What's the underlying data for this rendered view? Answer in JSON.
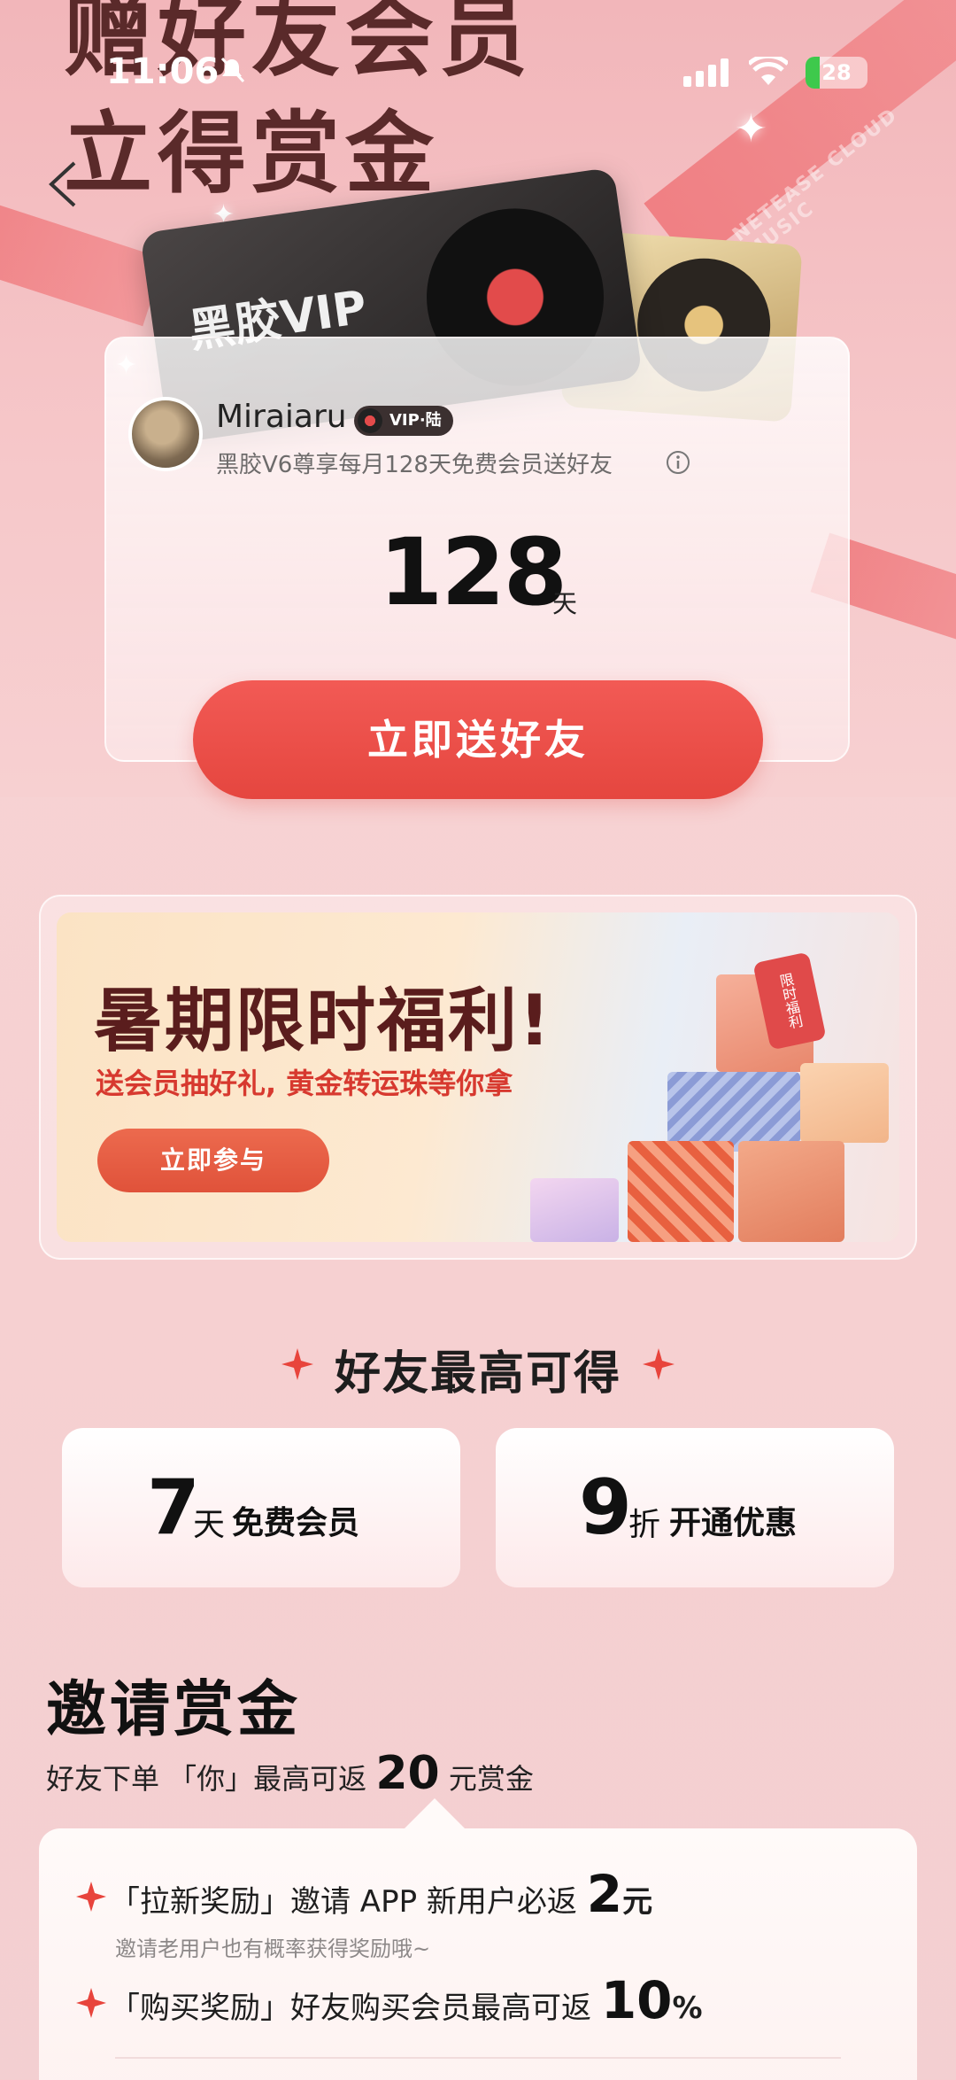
{
  "status_bar": {
    "time": "11:06",
    "battery": "28"
  },
  "hero": {
    "headline_line1": "赠好友会员",
    "headline_line2": "立得赏金",
    "ribbon_text": "NETEASE CLOUD MUSIC",
    "vinyl_card_text": "黑胶VIP"
  },
  "profile": {
    "username": "Miraiaru",
    "vip_badge": "VIP·陆",
    "description": "黑胶V6尊享每月128天免费会员送好友",
    "days_value": "128",
    "days_unit": "天",
    "send_button": "立即送好友"
  },
  "promo": {
    "title": "暑期限时福利!",
    "subtitle": "送会员抽好礼, 黄金转运珠等你拿",
    "button": "立即参与",
    "tag": "限时福利"
  },
  "friends": {
    "title": "好友最高可得",
    "benefit1": {
      "num": "7",
      "unit": "天",
      "label": "免费会员"
    },
    "benefit2": {
      "num": "9",
      "unit": "折",
      "label": "开通优惠"
    }
  },
  "bounty": {
    "title": "邀请赏金",
    "sub_prefix": "好友下单 「你」最高可返",
    "sub_amount": "20",
    "sub_suffix": "元赏金",
    "rule1_text": "「拉新奖励」邀请 APP 新用户必返",
    "rule1_amount": "2",
    "rule1_unit": "元",
    "rule1_note": "邀请老用户也有概率获得奖励哦~",
    "rule2_text": "「购买奖励」好友购买会员最高可返",
    "rule2_amount": "10",
    "rule2_unit": "%"
  },
  "colors": {
    "accent": "#e5463f",
    "headline": "#5a2a2a",
    "page_bg": "#f6cfd0"
  }
}
